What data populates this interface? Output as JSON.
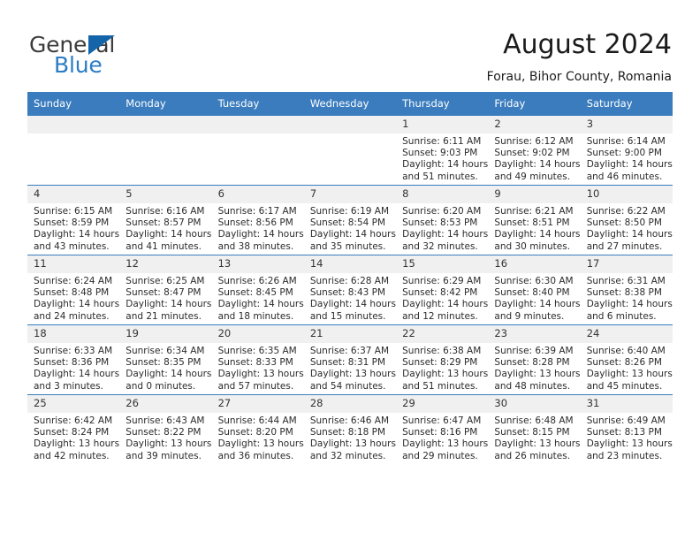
{
  "brand": {
    "name_top": "General",
    "name_bottom": "Blue",
    "accent_color": "#1464aa",
    "blue_text_color": "#2b7cc4"
  },
  "header": {
    "title": "August 2024",
    "subtitle": "Forau, Bihor County, Romania"
  },
  "calendar": {
    "header_bg": "#3a7cbe",
    "daynum_bg": "#f0f0f0",
    "weekday_headers": [
      "Sunday",
      "Monday",
      "Tuesday",
      "Wednesday",
      "Thursday",
      "Friday",
      "Saturday"
    ],
    "weeks": [
      [
        {
          "day": "",
          "lines": []
        },
        {
          "day": "",
          "lines": []
        },
        {
          "day": "",
          "lines": []
        },
        {
          "day": "",
          "lines": []
        },
        {
          "day": "1",
          "lines": [
            "Sunrise: 6:11 AM",
            "Sunset: 9:03 PM",
            "Daylight: 14 hours",
            "and 51 minutes."
          ]
        },
        {
          "day": "2",
          "lines": [
            "Sunrise: 6:12 AM",
            "Sunset: 9:02 PM",
            "Daylight: 14 hours",
            "and 49 minutes."
          ]
        },
        {
          "day": "3",
          "lines": [
            "Sunrise: 6:14 AM",
            "Sunset: 9:00 PM",
            "Daylight: 14 hours",
            "and 46 minutes."
          ]
        }
      ],
      [
        {
          "day": "4",
          "lines": [
            "Sunrise: 6:15 AM",
            "Sunset: 8:59 PM",
            "Daylight: 14 hours",
            "and 43 minutes."
          ]
        },
        {
          "day": "5",
          "lines": [
            "Sunrise: 6:16 AM",
            "Sunset: 8:57 PM",
            "Daylight: 14 hours",
            "and 41 minutes."
          ]
        },
        {
          "day": "6",
          "lines": [
            "Sunrise: 6:17 AM",
            "Sunset: 8:56 PM",
            "Daylight: 14 hours",
            "and 38 minutes."
          ]
        },
        {
          "day": "7",
          "lines": [
            "Sunrise: 6:19 AM",
            "Sunset: 8:54 PM",
            "Daylight: 14 hours",
            "and 35 minutes."
          ]
        },
        {
          "day": "8",
          "lines": [
            "Sunrise: 6:20 AM",
            "Sunset: 8:53 PM",
            "Daylight: 14 hours",
            "and 32 minutes."
          ]
        },
        {
          "day": "9",
          "lines": [
            "Sunrise: 6:21 AM",
            "Sunset: 8:51 PM",
            "Daylight: 14 hours",
            "and 30 minutes."
          ]
        },
        {
          "day": "10",
          "lines": [
            "Sunrise: 6:22 AM",
            "Sunset: 8:50 PM",
            "Daylight: 14 hours",
            "and 27 minutes."
          ]
        }
      ],
      [
        {
          "day": "11",
          "lines": [
            "Sunrise: 6:24 AM",
            "Sunset: 8:48 PM",
            "Daylight: 14 hours",
            "and 24 minutes."
          ]
        },
        {
          "day": "12",
          "lines": [
            "Sunrise: 6:25 AM",
            "Sunset: 8:47 PM",
            "Daylight: 14 hours",
            "and 21 minutes."
          ]
        },
        {
          "day": "13",
          "lines": [
            "Sunrise: 6:26 AM",
            "Sunset: 8:45 PM",
            "Daylight: 14 hours",
            "and 18 minutes."
          ]
        },
        {
          "day": "14",
          "lines": [
            "Sunrise: 6:28 AM",
            "Sunset: 8:43 PM",
            "Daylight: 14 hours",
            "and 15 minutes."
          ]
        },
        {
          "day": "15",
          "lines": [
            "Sunrise: 6:29 AM",
            "Sunset: 8:42 PM",
            "Daylight: 14 hours",
            "and 12 minutes."
          ]
        },
        {
          "day": "16",
          "lines": [
            "Sunrise: 6:30 AM",
            "Sunset: 8:40 PM",
            "Daylight: 14 hours",
            "and 9 minutes."
          ]
        },
        {
          "day": "17",
          "lines": [
            "Sunrise: 6:31 AM",
            "Sunset: 8:38 PM",
            "Daylight: 14 hours",
            "and 6 minutes."
          ]
        }
      ],
      [
        {
          "day": "18",
          "lines": [
            "Sunrise: 6:33 AM",
            "Sunset: 8:36 PM",
            "Daylight: 14 hours",
            "and 3 minutes."
          ]
        },
        {
          "day": "19",
          "lines": [
            "Sunrise: 6:34 AM",
            "Sunset: 8:35 PM",
            "Daylight: 14 hours",
            "and 0 minutes."
          ]
        },
        {
          "day": "20",
          "lines": [
            "Sunrise: 6:35 AM",
            "Sunset: 8:33 PM",
            "Daylight: 13 hours",
            "and 57 minutes."
          ]
        },
        {
          "day": "21",
          "lines": [
            "Sunrise: 6:37 AM",
            "Sunset: 8:31 PM",
            "Daylight: 13 hours",
            "and 54 minutes."
          ]
        },
        {
          "day": "22",
          "lines": [
            "Sunrise: 6:38 AM",
            "Sunset: 8:29 PM",
            "Daylight: 13 hours",
            "and 51 minutes."
          ]
        },
        {
          "day": "23",
          "lines": [
            "Sunrise: 6:39 AM",
            "Sunset: 8:28 PM",
            "Daylight: 13 hours",
            "and 48 minutes."
          ]
        },
        {
          "day": "24",
          "lines": [
            "Sunrise: 6:40 AM",
            "Sunset: 8:26 PM",
            "Daylight: 13 hours",
            "and 45 minutes."
          ]
        }
      ],
      [
        {
          "day": "25",
          "lines": [
            "Sunrise: 6:42 AM",
            "Sunset: 8:24 PM",
            "Daylight: 13 hours",
            "and 42 minutes."
          ]
        },
        {
          "day": "26",
          "lines": [
            "Sunrise: 6:43 AM",
            "Sunset: 8:22 PM",
            "Daylight: 13 hours",
            "and 39 minutes."
          ]
        },
        {
          "day": "27",
          "lines": [
            "Sunrise: 6:44 AM",
            "Sunset: 8:20 PM",
            "Daylight: 13 hours",
            "and 36 minutes."
          ]
        },
        {
          "day": "28",
          "lines": [
            "Sunrise: 6:46 AM",
            "Sunset: 8:18 PM",
            "Daylight: 13 hours",
            "and 32 minutes."
          ]
        },
        {
          "day": "29",
          "lines": [
            "Sunrise: 6:47 AM",
            "Sunset: 8:16 PM",
            "Daylight: 13 hours",
            "and 29 minutes."
          ]
        },
        {
          "day": "30",
          "lines": [
            "Sunrise: 6:48 AM",
            "Sunset: 8:15 PM",
            "Daylight: 13 hours",
            "and 26 minutes."
          ]
        },
        {
          "day": "31",
          "lines": [
            "Sunrise: 6:49 AM",
            "Sunset: 8:13 PM",
            "Daylight: 13 hours",
            "and 23 minutes."
          ]
        }
      ]
    ]
  }
}
